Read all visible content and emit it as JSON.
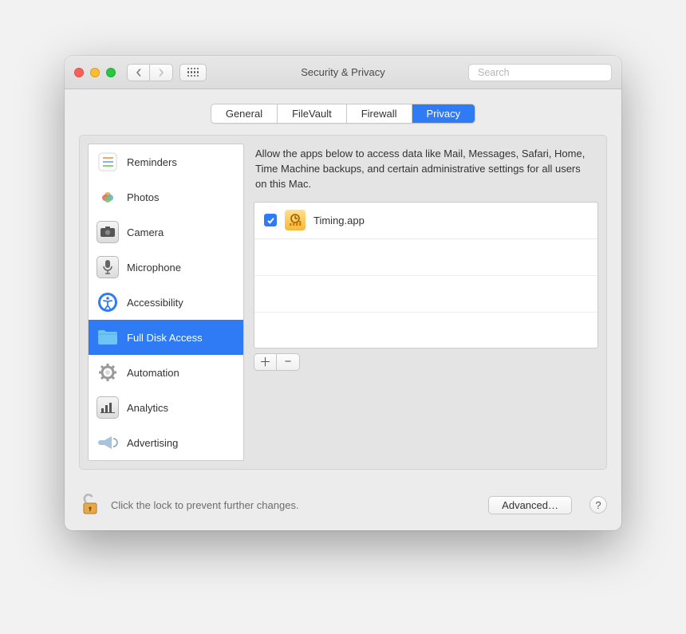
{
  "window": {
    "title": "Security & Privacy",
    "search_placeholder": "Search"
  },
  "tabs": {
    "items": [
      {
        "label": "General",
        "active": false
      },
      {
        "label": "FileVault",
        "active": false
      },
      {
        "label": "Firewall",
        "active": false
      },
      {
        "label": "Privacy",
        "active": true
      }
    ]
  },
  "sidebar": {
    "items": [
      {
        "label": "Reminders",
        "icon": "reminders-icon",
        "selected": false
      },
      {
        "label": "Photos",
        "icon": "photos-icon",
        "selected": false
      },
      {
        "label": "Camera",
        "icon": "camera-icon",
        "selected": false
      },
      {
        "label": "Microphone",
        "icon": "microphone-icon",
        "selected": false
      },
      {
        "label": "Accessibility",
        "icon": "accessibility-icon",
        "selected": false
      },
      {
        "label": "Full Disk Access",
        "icon": "folder-icon",
        "selected": true
      },
      {
        "label": "Automation",
        "icon": "gear-icon",
        "selected": false
      },
      {
        "label": "Analytics",
        "icon": "analytics-icon",
        "selected": false
      },
      {
        "label": "Advertising",
        "icon": "megaphone-icon",
        "selected": false
      }
    ]
  },
  "detail": {
    "description": "Allow the apps below to access data like Mail, Messages, Safari, Home, Time Machine backups, and certain administrative settings for all users on this Mac.",
    "apps": [
      {
        "name": "Timing.app",
        "checked": true
      }
    ]
  },
  "footer": {
    "lock_text": "Click the lock to prevent further changes.",
    "advanced_label": "Advanced…",
    "help_label": "?"
  }
}
